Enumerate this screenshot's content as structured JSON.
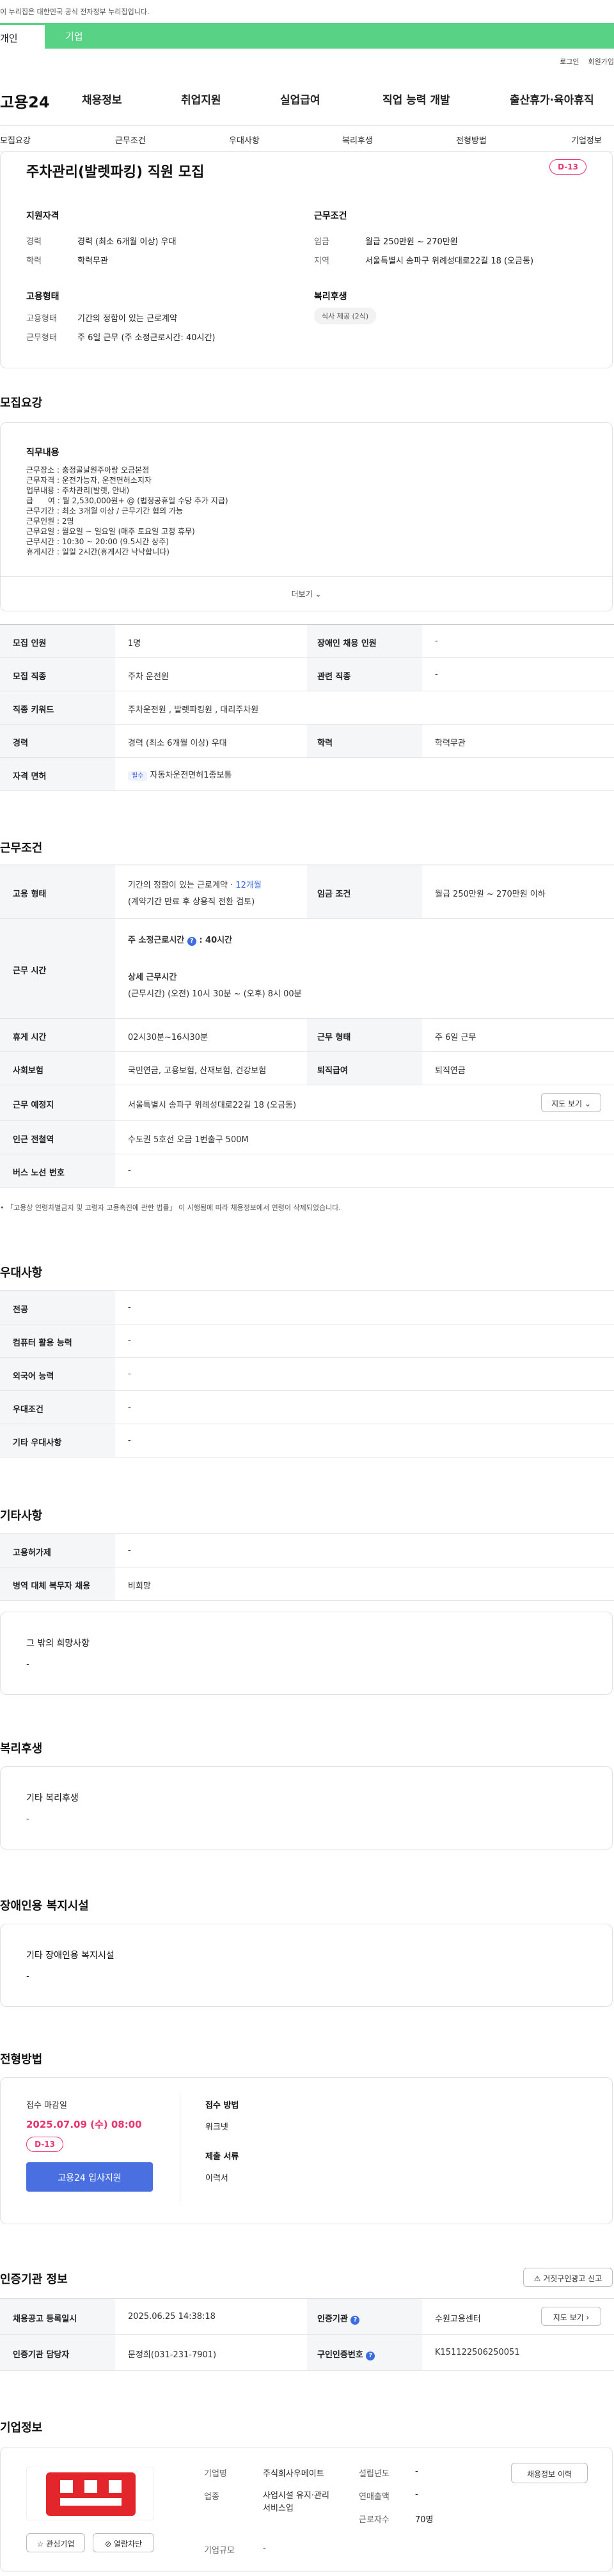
{
  "gov_banner": "이 누리집은 대한민국 공식 전자정부 누리집입니다.",
  "categories": [
    "개인",
    "기업"
  ],
  "util": [
    "로그인",
    "회원가입"
  ],
  "logo": "고용24",
  "gnb": [
    "채용정보",
    "취업지원",
    "실업급여",
    "직업 능력 개발",
    "출산휴가·육아휴직"
  ],
  "tabs": [
    "모집요강",
    "근무조건",
    "우대사항",
    "복리후생",
    "전형방법",
    "기업정보"
  ],
  "job": {
    "title": "주차관리(발렛파킹) 직원 모집",
    "dday": "D-13",
    "qual_title": "지원자격",
    "cond_title": "근무조건",
    "career_label": "경력",
    "career": "경력 (최소 6개월 이상) 우대",
    "edu_label": "학력",
    "edu": "학력무관",
    "wage_label": "임금",
    "wage": "월급 250만원 ~ 270만원",
    "region_label": "지역",
    "region": "서울특별시 송파구 위례성대로22길 18 (오금동)",
    "emp_title": "고용형태",
    "welfare_title": "복리후생",
    "emp_type_label": "고용형태",
    "emp_type": "기간의 정함이 있는 근로계약",
    "work_label": "근무형태",
    "work": "주 6일 근무 (주 소정근로시간: 40시간)",
    "welfare_pill": "식사 제공 (2식)"
  },
  "recruit": {
    "heading": "모집요강",
    "duty_title": "직무내용",
    "duty_lines": [
      "근무장소 : 충정골날원주아랑 오금본점",
      "근무자격 : 운전가능자, 운전면허소지자",
      "업무내용 : 주차관리(발렛, 안내)",
      "급      여 : 월 2,530,000원+ @ (법정공휴일 수당 추가 지급)",
      "근무기간 : 최소 3개월 이상 / 근무기간 협의 가능",
      "근무인원 : 2명",
      "근무요일 : 월요일 ~ 일요일 (매주 토요일 고정 휴무)",
      "근무시간 : 10:30 ~ 20:00 (9.5시간 상주)",
      "휴게시간 : 일일 2시간(휴게시간 낙낙합니다)"
    ],
    "more": "더보기",
    "rows": [
      {
        "k1": "모집 인원",
        "v1": "1명",
        "k2": "장애인 채용 인원",
        "v2": "-"
      },
      {
        "k1": "모집 직종",
        "v1": "주차 운전원",
        "k2": "관련 직종",
        "v2": "-"
      },
      {
        "k1": "직종 키워드",
        "v1": "주차운전원 , 발렛파킹원 , 대리주차원"
      },
      {
        "k1": "경력",
        "v1": "경력 (최소 6개월 이상) 우대",
        "k2": "학력",
        "v2": "학력무관"
      },
      {
        "k1": "자격 면허",
        "chip": "필수",
        "v1": "자동차운전면허1종보통"
      }
    ]
  },
  "conditions": {
    "heading": "근무조건",
    "emp_label": "고용 형태",
    "emp_val": "기간의 정함이 있는 근로계약 · ",
    "emp_months": "12개월",
    "emp_note": "(계약기간 만료 후 상용직 전환 검토)",
    "wage_label": "임금 조건",
    "wage_val": "월급 250만원 ~ 270만원 이하",
    "time_label": "근무 시간",
    "time_weekly": "주 소정근로시간",
    "time_weekly_val": ": 40시간",
    "time_detail_title": "상세 근무시간",
    "time_detail": "(근무시간) (오전) 10시 30분 ~ (오후) 8시 00분",
    "rest_label": "휴게 시간",
    "rest_val": "02시30분~16시30분",
    "form_label": "근무 형태",
    "form_val": "주 6일 근무",
    "ins_label": "사회보험",
    "ins_val": "국민연금, 고용보험, 산재보험, 건강보험",
    "ret_label": "퇴직급여",
    "ret_val": "퇴직연금",
    "place_label": "근무 예정지",
    "place_val": "서울특별시 송파구 위례성대로22길 18 (오금동)",
    "map_btn": "지도 보기",
    "subway_label": "인근 전철역",
    "subway_val": "수도권 5호선 오금 1번출구 500M",
    "bus_label": "버스 노선 번호",
    "bus_val": "-",
    "note": "「고용상 연령차별금지 및 고령자 고용촉진에 관한 법률」 이 시행됨에 따라 채용정보에서 연령이 삭제되었습니다."
  },
  "pref": {
    "heading": "우대사항",
    "rows": [
      {
        "k": "전공",
        "v": "-"
      },
      {
        "k": "컴퓨터 활용 능력",
        "v": "-"
      },
      {
        "k": "외국어 능력",
        "v": "-"
      },
      {
        "k": "우대조건",
        "v": "-"
      },
      {
        "k": "기타 우대사항",
        "v": "-"
      }
    ]
  },
  "etc": {
    "heading": "기타사항",
    "rows": [
      {
        "k": "고용허가제",
        "v": "-"
      },
      {
        "k": "병역 대체 복무자 채용",
        "v": "비희망"
      }
    ],
    "hope_title": "그 밖의 희망사항",
    "hope_val": "-"
  },
  "welfare": {
    "heading": "복리후생",
    "title": "기타 복리후생",
    "val": "-"
  },
  "disabled": {
    "heading": "장애인용 복지시설",
    "title": "기타 장애인용 복지시설",
    "val": "-"
  },
  "process": {
    "heading": "전형방법",
    "deadline_title": "접수 마감일",
    "deadline": "2025.07.09 (수) 08:00",
    "dday": "D-13",
    "apply_btn": "고용24 입사지원",
    "method_title": "접수 방법",
    "method": "워크넷",
    "docs_title": "제출 서류",
    "docs": "이력서"
  },
  "agency": {
    "heading": "인증기관 정보",
    "report_btn": "거짓구인광고 신고",
    "reg_label": "채용공고 등록일시",
    "reg_val": "2025.06.25 14:38:18",
    "org_label": "인증기관",
    "org_val": "수원고용센터",
    "map_btn": "지도 보기",
    "mgr_label": "인증기관 담당자",
    "mgr_val": "문정희(031-231-7901)",
    "no_label": "구인인증번호",
    "no_val": "K151122506250051"
  },
  "company": {
    "heading": "기업정보",
    "name_label": "기업명",
    "name": "주식회사우메이트",
    "ind_label": "업종",
    "ind": "사업시설 유지·관리 서비스업",
    "size_label": "기업규모",
    "size": "-",
    "year_label": "설립년도",
    "year": "-",
    "sales_label": "연매출액",
    "sales": "-",
    "emp_label": "근로자수",
    "emp": "70명",
    "btn_list": "채용정보 이력",
    "btn_fav": "관심기업",
    "btn_block": "열람차단",
    "logo_color": "#e3262b"
  }
}
